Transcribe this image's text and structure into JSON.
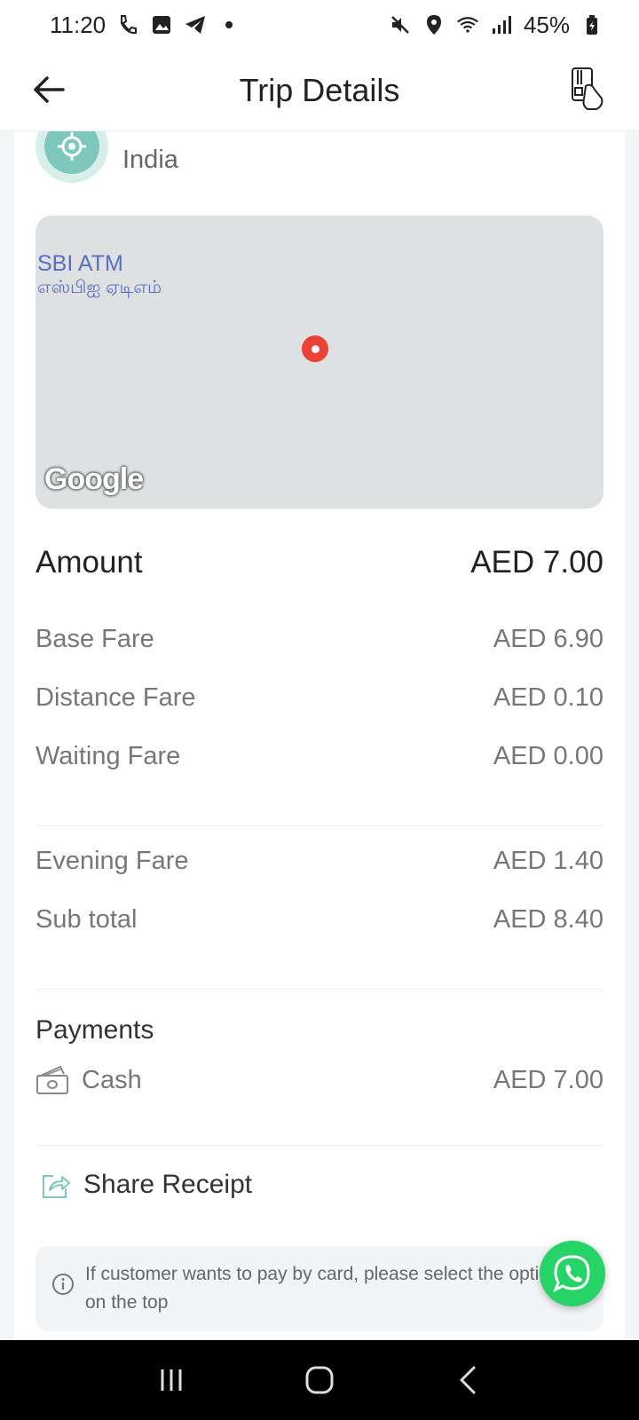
{
  "status_bar": {
    "time": "11:20",
    "battery": "45%"
  },
  "header": {
    "title": "Trip Details",
    "back_icon": "arrow-left-icon",
    "card_icon": "card-payment-icon"
  },
  "location": {
    "text": "India"
  },
  "map": {
    "place_label": "SBI ATM",
    "place_label_local": "எஸ்பிஐ ஏடிஎம்",
    "provider": "Google"
  },
  "amount": {
    "label": "Amount",
    "value": "AED 7.00"
  },
  "fares": [
    {
      "label": "Base Fare",
      "value": "AED 6.90"
    },
    {
      "label": "Distance Fare",
      "value": "AED 0.10"
    },
    {
      "label": "Waiting Fare",
      "value": "AED 0.00"
    }
  ],
  "extra_fares": [
    {
      "label": "Evening Fare",
      "value": "AED 1.40"
    },
    {
      "label": "Sub total",
      "value": "AED 8.40"
    }
  ],
  "payments": {
    "title": "Payments",
    "method": "Cash",
    "value": "AED 7.00"
  },
  "share": {
    "label": "Share Receipt"
  },
  "info": {
    "text": "If customer wants to pay by card, please select the option on the top"
  },
  "colors": {
    "accent_teal": "#7ec7bd",
    "whatsapp_green": "#25d366",
    "map_pin": "#ea4335"
  }
}
